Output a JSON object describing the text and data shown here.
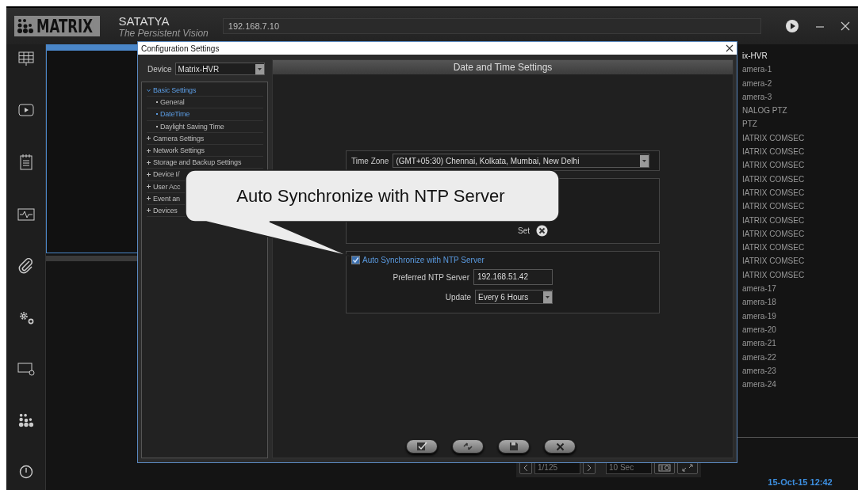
{
  "app": {
    "logo": "MATRIX",
    "product": "SATATYA",
    "tagline": "The Persistent Vision",
    "address": "192.168.7.10"
  },
  "pager": {
    "page": "1/125",
    "interval": "10 Sec"
  },
  "camera_list": [
    {
      "label": "ix-HVR",
      "kind": "device"
    },
    {
      "label": "amera-1",
      "kind": "camera"
    },
    {
      "label": "amera-2",
      "kind": "camera"
    },
    {
      "label": "amera-3",
      "kind": "camera"
    },
    {
      "label": "NALOG PTZ",
      "kind": "camera"
    },
    {
      "label": "PTZ",
      "kind": "camera"
    },
    {
      "label": "IATRIX COMSEC",
      "kind": "camera"
    },
    {
      "label": "IATRIX COMSEC",
      "kind": "camera"
    },
    {
      "label": "IATRIX COMSEC",
      "kind": "camera"
    },
    {
      "label": "IATRIX COMSEC",
      "kind": "camera"
    },
    {
      "label": "IATRIX COMSEC",
      "kind": "camera"
    },
    {
      "label": "IATRIX COMSEC",
      "kind": "camera"
    },
    {
      "label": "IATRIX COMSEC",
      "kind": "camera"
    },
    {
      "label": "IATRIX COMSEC",
      "kind": "camera"
    },
    {
      "label": "IATRIX COMSEC",
      "kind": "camera"
    },
    {
      "label": "IATRIX COMSEC",
      "kind": "camera"
    },
    {
      "label": "IATRIX COMSEC",
      "kind": "camera"
    },
    {
      "label": "amera-17",
      "kind": "camera"
    },
    {
      "label": "amera-18",
      "kind": "camera"
    },
    {
      "label": "amera-19",
      "kind": "camera"
    },
    {
      "label": "amera-20",
      "kind": "camera"
    },
    {
      "label": "amera-21",
      "kind": "camera"
    },
    {
      "label": "amera-22",
      "kind": "camera"
    },
    {
      "label": "amera-23",
      "kind": "camera"
    },
    {
      "label": "amera-24",
      "kind": "camera"
    }
  ],
  "datetime": "15-Oct-15 12:42",
  "dialog": {
    "title": "Configuration Settings",
    "device_label": "Device",
    "device": "Matrix-HVR",
    "tree": [
      {
        "label": "Basic Settings",
        "expanded": true,
        "children": [
          {
            "label": "General",
            "selected": false
          },
          {
            "label": "DateTime",
            "selected": true
          },
          {
            "label": "Daylight Saving Time",
            "selected": false
          }
        ]
      },
      {
        "label": "Camera Settings",
        "expanded": false
      },
      {
        "label": "Network Settings",
        "expanded": false
      },
      {
        "label": "Storage and Backup Settings",
        "expanded": false
      },
      {
        "label": "Device I/",
        "expanded": false
      },
      {
        "label": "User Acc",
        "expanded": false
      },
      {
        "label": "Event an",
        "expanded": false
      },
      {
        "label": "Devices",
        "expanded": false
      }
    ],
    "header": "Date and Time Settings",
    "time_zone_label": "Time Zone",
    "time_zone": "(GMT+05:30) Chennai, Kolkata, Mumbai, New Delhi",
    "set_label": "Set",
    "ntp": {
      "label": "Auto Synchronize with NTP Server",
      "checked": true,
      "server_label": "Preferred NTP Server",
      "server": "192.168.51.42",
      "update_label": "Update",
      "update": "Every 6 Hours"
    }
  },
  "callout": {
    "text": "Auto Synchronize with NTP Server"
  }
}
